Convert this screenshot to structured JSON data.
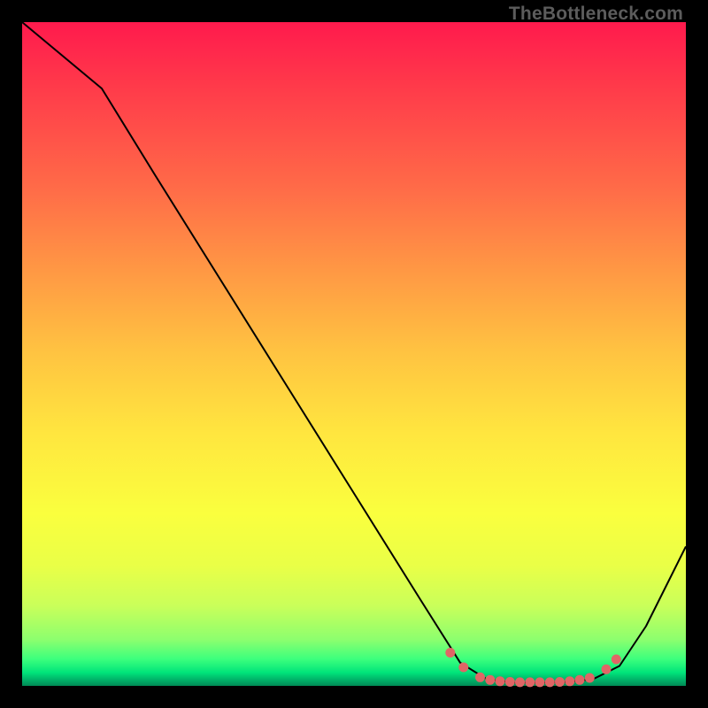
{
  "watermark": "TheBottleneck.com",
  "colors": {
    "background": "#000000",
    "curve": "#000000",
    "dots": "#e06666"
  },
  "chart_data": {
    "type": "line",
    "title": "",
    "xlabel": "",
    "ylabel": "",
    "xlim": [
      0,
      100
    ],
    "ylim": [
      0,
      100
    ],
    "grid": false,
    "series": [
      {
        "name": "bottleneck-curve",
        "x": [
          0,
          12,
          20,
          30,
          40,
          50,
          60,
          66,
          70,
          74,
          78,
          82,
          86,
          90,
          94,
          100
        ],
        "y": [
          100,
          90,
          77,
          61,
          45,
          29,
          13,
          3.5,
          1.0,
          0.5,
          0.5,
          0.6,
          1.0,
          3.0,
          9.0,
          21
        ]
      }
    ],
    "markers": {
      "name": "valley-dots",
      "x": [
        64.5,
        66.5,
        69,
        70.5,
        72,
        73.5,
        75,
        76.5,
        78,
        79.5,
        81,
        82.5,
        84,
        85.5,
        88,
        89.5
      ],
      "y": [
        5.0,
        2.8,
        1.3,
        0.9,
        0.7,
        0.6,
        0.55,
        0.55,
        0.55,
        0.55,
        0.6,
        0.7,
        0.9,
        1.2,
        2.5,
        4.0
      ]
    }
  }
}
